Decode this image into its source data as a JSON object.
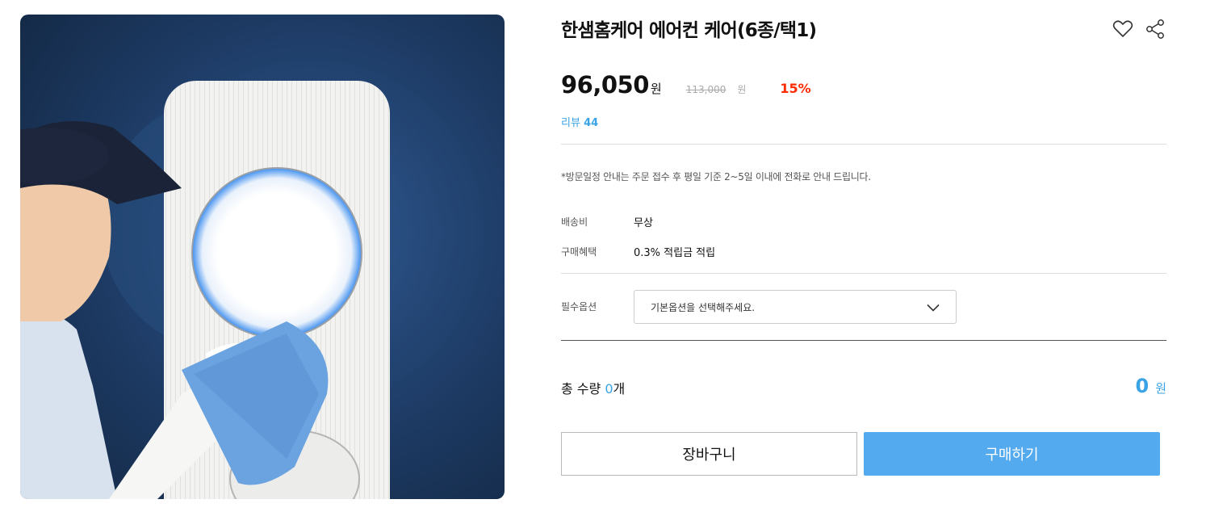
{
  "product": {
    "title": "한샘홈케어 에어컨 케어(6종/택1)",
    "sale_price": "96,050",
    "sale_unit": "원",
    "original_price": "113,000",
    "original_unit": "원",
    "discount": "15%",
    "review_label": "리뷰",
    "review_count": "44",
    "notice": "*방문일정 안내는 주문 접수 후 평일 기준 2~5일 이내에 전화로 안내 드립니다."
  },
  "icons": {
    "like": "heart-icon",
    "share": "share-icon",
    "dropdown": "chevron-down-icon"
  },
  "info_rows": {
    "shipping_label": "배송비",
    "shipping_value": "무상",
    "benefit_label": "구매혜택",
    "benefit_value": "0.3% 적립금 적립"
  },
  "option": {
    "label": "필수옵션",
    "placeholder": "기본옵션을 선택해주세요."
  },
  "total": {
    "label_prefix": "총 수량 ",
    "quantity": "0",
    "label_suffix": "개",
    "price": "0",
    "unit": "원"
  },
  "buttons": {
    "cart": "장바구니",
    "buy": "구매하기"
  },
  "colors": {
    "accent": "#3aa3e6",
    "buy_button": "#53aaee",
    "discount": "#ff2a00"
  }
}
